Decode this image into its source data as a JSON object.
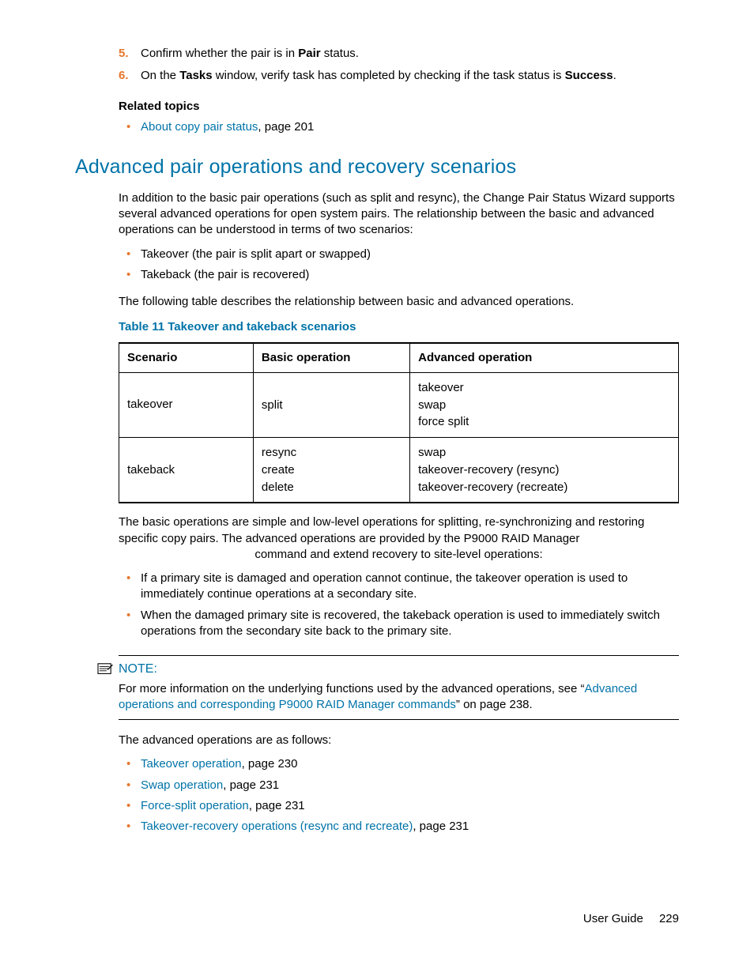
{
  "steps": [
    {
      "num": "5.",
      "pre": "Confirm whether the pair is in ",
      "bold1": "Pair",
      "post": " status."
    },
    {
      "num": "6.",
      "pre": "On the ",
      "bold1": "Tasks",
      "mid": " window, verify task has completed by checking if the task status is ",
      "bold2": "Success",
      "post": "."
    }
  ],
  "related": {
    "heading": "Related topics",
    "item_link": "About copy pair status",
    "item_suffix": ", page 201"
  },
  "section_title": "Advanced pair operations and recovery scenarios",
  "intro_para": "In addition to the basic pair operations (such as split and resync), the Change Pair Status Wizard supports several advanced operations for open system pairs. The relationship between the basic and advanced operations can be understood in terms of two scenarios:",
  "scenario_bullets": [
    "Takeover (the pair is split apart or swapped)",
    "Takeback (the pair is recovered)"
  ],
  "table_intro": "The following table describes the relationship between basic and advanced operations.",
  "table_title": "Table 11 Takeover and takeback scenarios",
  "table": {
    "headers": [
      "Scenario",
      "Basic operation",
      "Advanced operation"
    ],
    "rows": [
      {
        "scenario": "takeover",
        "basic": [
          "split"
        ],
        "advanced": [
          "takeover",
          "swap",
          "force split"
        ]
      },
      {
        "scenario": "takeback",
        "basic": [
          "resync",
          "create",
          "delete"
        ],
        "advanced": [
          "swap",
          "takeover-recovery (resync)",
          "takeover-recovery (recreate)"
        ]
      }
    ]
  },
  "after_table_para": "The basic operations are simple and low-level operations for splitting, re-synchronizing and restoring specific copy pairs. The advanced operations are provided by the P9000 RAID Manager",
  "after_table_para_cont": "command and extend recovery to site-level operations:",
  "site_bullets": [
    "If a primary site is damaged and operation cannot continue, the takeover operation is used to immediately continue operations at a secondary site.",
    "When the damaged primary site is recovered, the takeback operation is used to immediately switch operations from the secondary site back to the primary site."
  ],
  "note": {
    "label": "NOTE:",
    "pre": "For more information on the underlying functions used by the advanced operations, see “",
    "link": "Advanced operations and corresponding P9000 RAID Manager commands",
    "post": "” on page 238."
  },
  "ops_intro": "The advanced operations are as follows:",
  "ops_list": [
    {
      "link": "Takeover operation",
      "suffix": ", page 230"
    },
    {
      "link": "Swap operation",
      "suffix": ", page 231"
    },
    {
      "link": "Force-split operation",
      "suffix": ", page 231"
    },
    {
      "link": "Takeover-recovery operations (resync and recreate)",
      "suffix": ", page 231"
    }
  ],
  "footer": {
    "label": "User Guide",
    "page": "229"
  }
}
